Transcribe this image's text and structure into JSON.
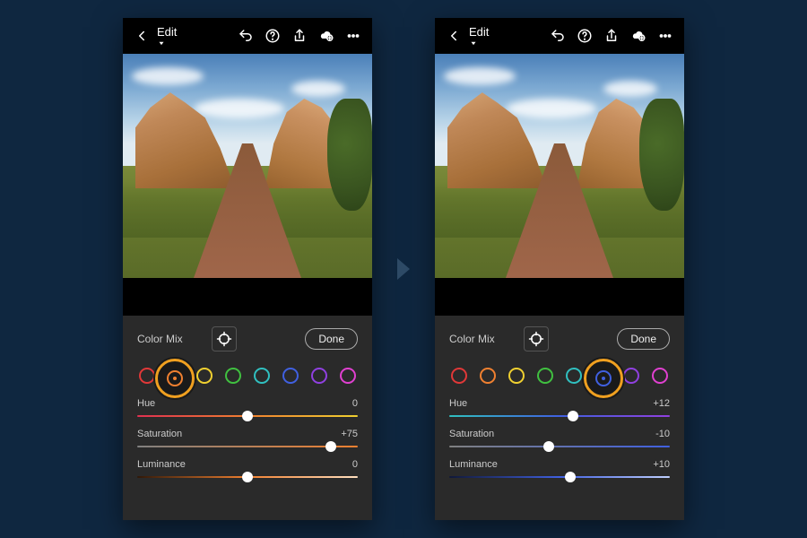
{
  "topbar": {
    "edit_label": "Edit"
  },
  "panel": {
    "title": "Color Mix",
    "done_label": "Done",
    "swatch_colors": [
      "#e03838",
      "#f08030",
      "#f0d030",
      "#40c040",
      "#30c0c0",
      "#4060e0",
      "#9040e0",
      "#e040d0"
    ]
  },
  "screens": [
    {
      "selected_swatch_index": 1,
      "selected_swatch_color": "#f08030",
      "sliders": [
        {
          "name": "Hue",
          "value": "0",
          "pos": 50,
          "gradient": "linear-gradient(90deg,#e03050,#f08030,#f0d030)"
        },
        {
          "name": "Saturation",
          "value": "+75",
          "pos": 88,
          "gradient": "linear-gradient(90deg,#808080,#f08030)"
        },
        {
          "name": "Luminance",
          "value": "0",
          "pos": 50,
          "gradient": "linear-gradient(90deg,#301808,#f08030,#ffe0c0)"
        }
      ]
    },
    {
      "selected_swatch_index": 5,
      "selected_swatch_color": "#4060e0",
      "sliders": [
        {
          "name": "Hue",
          "value": "+12",
          "pos": 56,
          "gradient": "linear-gradient(90deg,#30c0c0,#4060e0,#9040e0)"
        },
        {
          "name": "Saturation",
          "value": "-10",
          "pos": 45,
          "gradient": "linear-gradient(90deg,#808080,#4060e0)"
        },
        {
          "name": "Luminance",
          "value": "+10",
          "pos": 55,
          "gradient": "linear-gradient(90deg,#101838,#4060e0,#c0d0ff)"
        }
      ]
    }
  ]
}
